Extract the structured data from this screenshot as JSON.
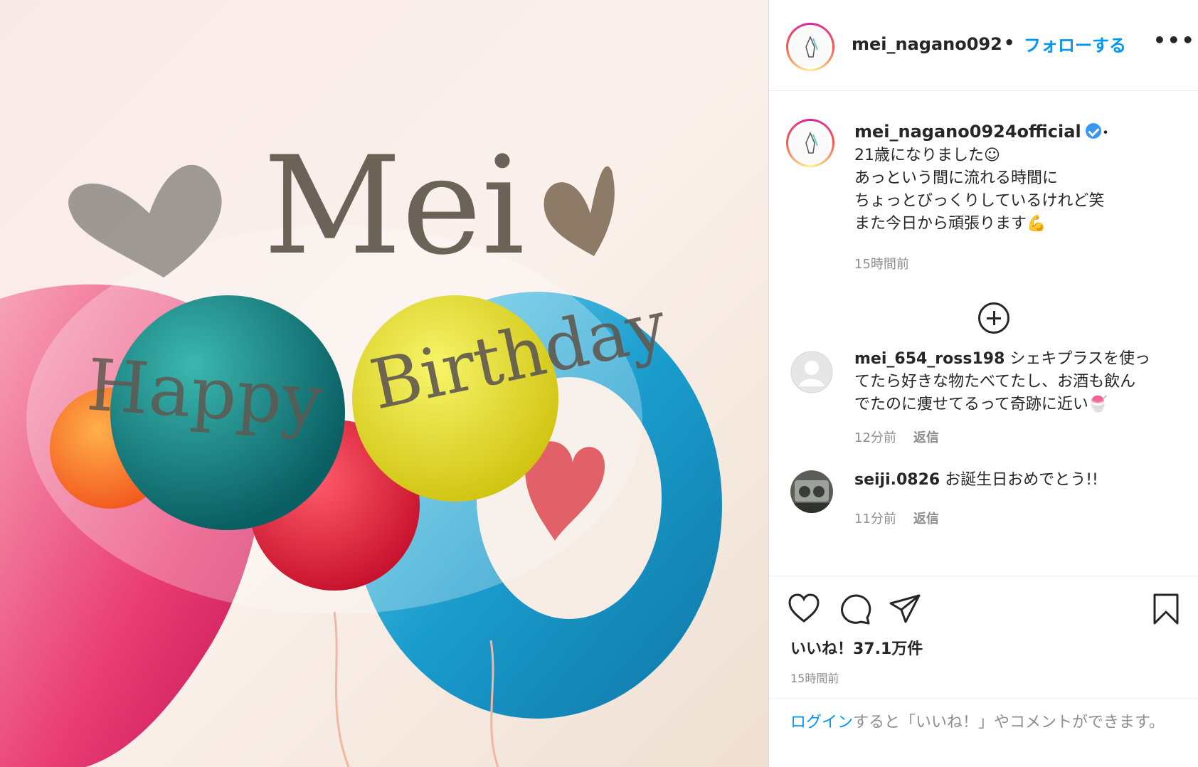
{
  "post": {
    "username": "mei_nagano0924official",
    "follow_label": "フォローする",
    "separator": "•",
    "more_label": "•••",
    "photo_alt": "Happy Birthday Mei balloons",
    "photo_text": {
      "name": "Mei",
      "greeting1": "Happy",
      "greeting2": "Birthday"
    }
  },
  "caption": {
    "username": "mei_nagano0924official",
    "dot": "・",
    "text": "21歳になりました☺︎\nあっという間に流れる時間に\nちょっとびっくりしているけれど笑\nまた今日から頑張ります💪",
    "time": "15時間前"
  },
  "comments": [
    {
      "username": "mei_654_ross198",
      "text_line1": " シェキプラスを使っ",
      "text_rest": "てたら好きな物たべてたし、お酒も飲ん\nでたのに痩せてるって奇跡に近い🍧",
      "time": "12分前",
      "reply": "返信"
    },
    {
      "username": "seiji.0826",
      "text_line1": " お誕生日おめでとう!!",
      "text_rest": "",
      "time": "11分前",
      "reply": "返信"
    }
  ],
  "actions": {
    "icons": [
      "heart-icon",
      "comment-icon",
      "share-icon",
      "bookmark-icon"
    ],
    "likes": "いいね！37.1万件",
    "time": "15時間前"
  },
  "login": {
    "link": "ログイン",
    "text": "すると「いいね！」やコメントができます。"
  },
  "colors": {
    "accent": "#0095f6",
    "verified": "#3897f0",
    "muted": "#8e8e8e"
  }
}
